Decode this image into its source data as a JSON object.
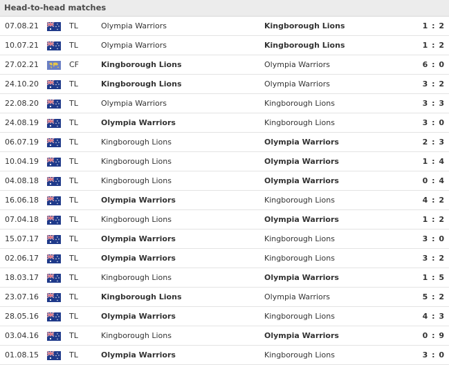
{
  "title": "Head-to-head matches",
  "colors": {
    "header_bg": "#ececec",
    "row_border": "#e3e3e3",
    "text": "#333333"
  },
  "matches": [
    {
      "date": "07.08.21",
      "flag": "australia-flag",
      "comp": "TL",
      "home": "Olympia Warriors",
      "away": "Kingborough Lions",
      "score": "1 : 2",
      "winner": "away"
    },
    {
      "date": "10.07.21",
      "flag": "australia-flag",
      "comp": "TL",
      "home": "Olympia Warriors",
      "away": "Kingborough Lions",
      "score": "1 : 2",
      "winner": "away"
    },
    {
      "date": "27.02.21",
      "flag": "world-flag",
      "comp": "CF",
      "home": "Kingborough Lions",
      "away": "Olympia Warriors",
      "score": "6 : 0",
      "winner": "home"
    },
    {
      "date": "24.10.20",
      "flag": "australia-flag",
      "comp": "TL",
      "home": "Kingborough Lions",
      "away": "Olympia Warriors",
      "score": "3 : 2",
      "winner": "home"
    },
    {
      "date": "22.08.20",
      "flag": "australia-flag",
      "comp": "TL",
      "home": "Olympia Warriors",
      "away": "Kingborough Lions",
      "score": "3 : 3",
      "winner": "none"
    },
    {
      "date": "24.08.19",
      "flag": "australia-flag",
      "comp": "TL",
      "home": "Olympia Warriors",
      "away": "Kingborough Lions",
      "score": "3 : 0",
      "winner": "home"
    },
    {
      "date": "06.07.19",
      "flag": "australia-flag",
      "comp": "TL",
      "home": "Kingborough Lions",
      "away": "Olympia Warriors",
      "score": "2 : 3",
      "winner": "away"
    },
    {
      "date": "10.04.19",
      "flag": "australia-flag",
      "comp": "TL",
      "home": "Kingborough Lions",
      "away": "Olympia Warriors",
      "score": "1 : 4",
      "winner": "away"
    },
    {
      "date": "04.08.18",
      "flag": "australia-flag",
      "comp": "TL",
      "home": "Kingborough Lions",
      "away": "Olympia Warriors",
      "score": "0 : 4",
      "winner": "away"
    },
    {
      "date": "16.06.18",
      "flag": "australia-flag",
      "comp": "TL",
      "home": "Olympia Warriors",
      "away": "Kingborough Lions",
      "score": "4 : 2",
      "winner": "home"
    },
    {
      "date": "07.04.18",
      "flag": "australia-flag",
      "comp": "TL",
      "home": "Kingborough Lions",
      "away": "Olympia Warriors",
      "score": "1 : 2",
      "winner": "away"
    },
    {
      "date": "15.07.17",
      "flag": "australia-flag",
      "comp": "TL",
      "home": "Olympia Warriors",
      "away": "Kingborough Lions",
      "score": "3 : 0",
      "winner": "home"
    },
    {
      "date": "02.06.17",
      "flag": "australia-flag",
      "comp": "TL",
      "home": "Olympia Warriors",
      "away": "Kingborough Lions",
      "score": "3 : 2",
      "winner": "home"
    },
    {
      "date": "18.03.17",
      "flag": "australia-flag",
      "comp": "TL",
      "home": "Kingborough Lions",
      "away": "Olympia Warriors",
      "score": "1 : 5",
      "winner": "away"
    },
    {
      "date": "23.07.16",
      "flag": "australia-flag",
      "comp": "TL",
      "home": "Kingborough Lions",
      "away": "Olympia Warriors",
      "score": "5 : 2",
      "winner": "home"
    },
    {
      "date": "28.05.16",
      "flag": "australia-flag",
      "comp": "TL",
      "home": "Olympia Warriors",
      "away": "Kingborough Lions",
      "score": "4 : 3",
      "winner": "home"
    },
    {
      "date": "03.04.16",
      "flag": "australia-flag",
      "comp": "TL",
      "home": "Kingborough Lions",
      "away": "Olympia Warriors",
      "score": "0 : 9",
      "winner": "away"
    },
    {
      "date": "01.08.15",
      "flag": "australia-flag",
      "comp": "TL",
      "home": "Olympia Warriors",
      "away": "Kingborough Lions",
      "score": "3 : 0",
      "winner": "home"
    }
  ]
}
